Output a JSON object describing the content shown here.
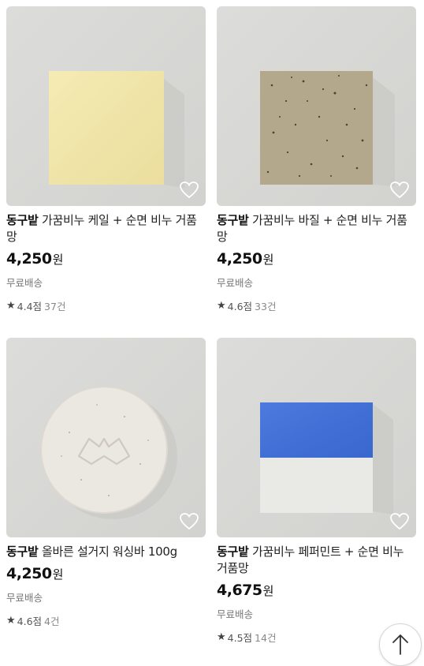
{
  "products": [
    {
      "brand": "동구밭",
      "name": "가꿈비누 케일 + 순면 비누 거품망",
      "price": "4,250",
      "currency": "원",
      "shipping": "무료배송",
      "rating": "4.4점",
      "reviews": "37건",
      "soap_color": "#f1e6a8",
      "image_icon": "yellow-square-soap"
    },
    {
      "brand": "동구밭",
      "name": "가꿈비누 바질 + 순면 비누 거품망",
      "price": "4,250",
      "currency": "원",
      "shipping": "무료배송",
      "rating": "4.6점",
      "reviews": "33건",
      "soap_color": "#b7ab8f",
      "image_icon": "speckled-square-soap"
    },
    {
      "brand": "동구밭",
      "name": "올바른 설거지 워싱바 100g",
      "price": "4,250",
      "currency": "원",
      "shipping": "무료배송",
      "rating": "4.6점",
      "reviews": "4건",
      "soap_color": "#ece8e3",
      "image_icon": "round-dish-soap"
    },
    {
      "brand": "동구밭",
      "name": "가꿈비누 페퍼민트 + 순면 비누 거품망",
      "price": "4,675",
      "currency": "원",
      "shipping": "무료배송",
      "rating": "4.5점",
      "reviews": "14건",
      "soap_color": "#3f6fd6",
      "image_icon": "blue-white-square-soap"
    }
  ],
  "colors": {
    "heart_outline": "#ffffff",
    "price": "#111111",
    "muted": "#777777"
  },
  "scroll_top_icon": "arrow-up-icon"
}
